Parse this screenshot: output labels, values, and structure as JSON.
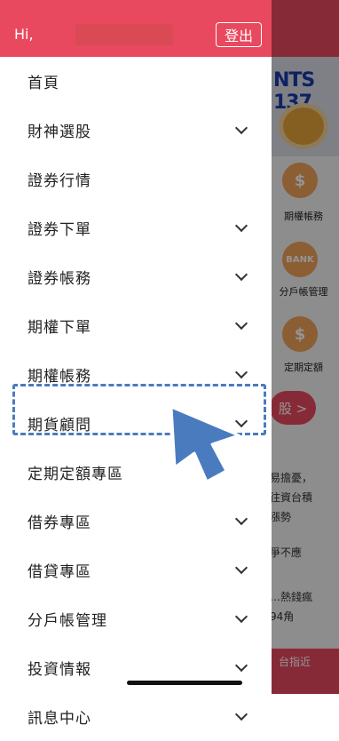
{
  "header": {
    "greeting": "Hi,",
    "logout_label": "登出"
  },
  "menu": {
    "items": [
      {
        "label": "首頁",
        "expandable": false
      },
      {
        "label": "財神選股",
        "expandable": true
      },
      {
        "label": "證券行情",
        "expandable": false
      },
      {
        "label": "證券下單",
        "expandable": true
      },
      {
        "label": "證券帳務",
        "expandable": true
      },
      {
        "label": "期權下單",
        "expandable": true
      },
      {
        "label": "期權帳務",
        "expandable": true
      },
      {
        "label": "期貨顧問",
        "expandable": true
      },
      {
        "label": "定期定額專區",
        "expandable": false
      },
      {
        "label": "借券專區",
        "expandable": true
      },
      {
        "label": "借貸專區",
        "expandable": true
      },
      {
        "label": "分戶帳管理",
        "expandable": true
      },
      {
        "label": "投資情報",
        "expandable": true
      },
      {
        "label": "訊息中心",
        "expandable": true
      }
    ]
  },
  "highlighted_item": "期貨顧問",
  "background": {
    "banner_text": "NTS 137",
    "shortcuts": [
      {
        "icon": "dollar-icon",
        "label": "期權帳務"
      },
      {
        "icon": "bank-card-icon",
        "label": "分戶帳管理"
      },
      {
        "icon": "piggy-bank-icon",
        "label": "定期定額"
      }
    ],
    "action_button": "股 >",
    "news_lines": [
      "易擔憂，",
      "往資台積",
      "漲勢",
      "爭不應",
      "…熱錢瘋",
      "94角"
    ],
    "bottom_text": "台指近"
  },
  "colors": {
    "brand": "#e8495f",
    "highlight_border": "#4a7bbf",
    "pointer": "#4a7bbf"
  }
}
